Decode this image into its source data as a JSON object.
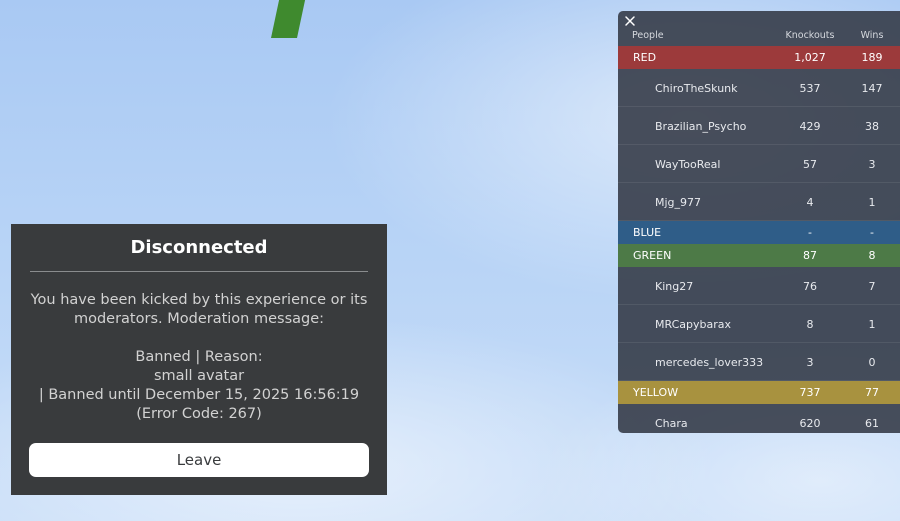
{
  "dialog": {
    "title": "Disconnected",
    "message_line1": "You have been kicked by this experience or its",
    "message_line2": "moderators. Moderation message:",
    "ban_line1": "Banned | Reason:",
    "ban_line2": "small avatar",
    "ban_line3": "| Banned until December 15, 2025 16:56:19",
    "error_code": "(Error Code: 267)",
    "leave_label": "Leave"
  },
  "leaderboard": {
    "close_icon": "close-icon",
    "headers": {
      "people": "People",
      "knockouts": "Knockouts",
      "wins": "Wins"
    },
    "teams": [
      {
        "name": "RED",
        "knockouts": "1,027",
        "wins": "189",
        "color": "#9c3a3b",
        "players": [
          {
            "name": "ChiroTheSkunk",
            "knockouts": "537",
            "wins": "147"
          },
          {
            "name": "Brazilian_Psycho",
            "knockouts": "429",
            "wins": "38"
          },
          {
            "name": "WayTooReal",
            "knockouts": "57",
            "wins": "3"
          },
          {
            "name": "Mjg_977",
            "knockouts": "4",
            "wins": "1"
          }
        ]
      },
      {
        "name": "BLUE",
        "knockouts": "-",
        "wins": "-",
        "color": "#2f5d88",
        "players": []
      },
      {
        "name": "GREEN",
        "knockouts": "87",
        "wins": "8",
        "color": "#4d7a47",
        "players": [
          {
            "name": "King27",
            "knockouts": "76",
            "wins": "7"
          },
          {
            "name": "MRCapybarax",
            "knockouts": "8",
            "wins": "1"
          },
          {
            "name": "mercedes_lover333",
            "knockouts": "3",
            "wins": "0"
          }
        ]
      },
      {
        "name": "YELLOW",
        "knockouts": "737",
        "wins": "77",
        "color": "#a8923f",
        "players": [
          {
            "name": "Chara",
            "knockouts": "620",
            "wins": "61"
          }
        ]
      }
    ]
  }
}
